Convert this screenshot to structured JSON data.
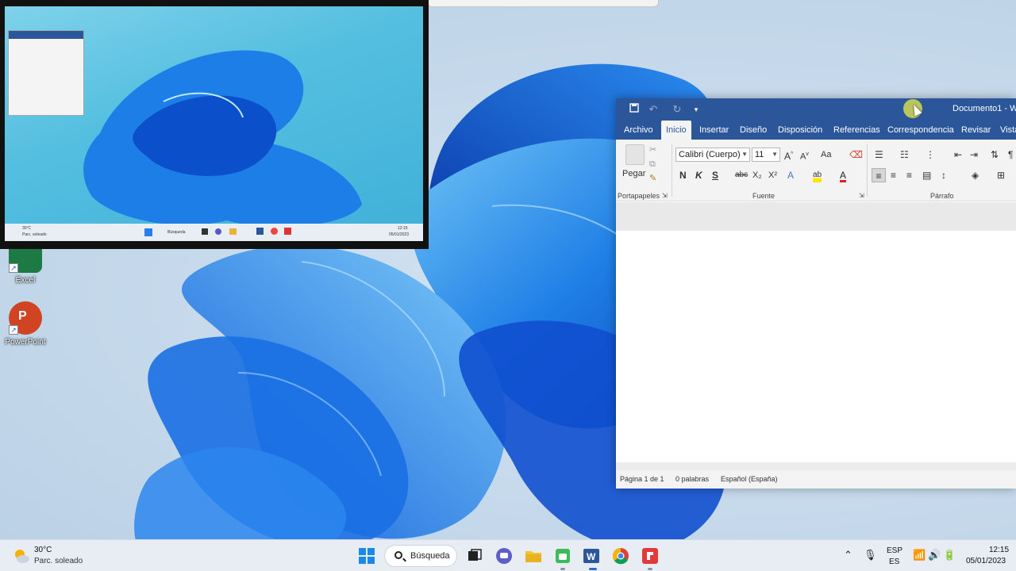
{
  "desktop": {
    "icons": [
      {
        "label": "Excel",
        "name": "excel"
      },
      {
        "label": "PowerPoint",
        "name": "powerpoint"
      }
    ]
  },
  "monitor_photo": {
    "weather_temp": "30°C",
    "weather_desc": "Parc. soleado",
    "search": "Búsqueda",
    "time": "12:15",
    "date": "05/01/2023"
  },
  "word": {
    "title": "Documento1 - W",
    "tabs": [
      "Archivo",
      "Inicio",
      "Insertar",
      "Diseño",
      "Disposición",
      "Referencias",
      "Correspondencia",
      "Revisar",
      "Vista"
    ],
    "active_tab": "Inicio",
    "clipboard": {
      "paste_label": "Pegar",
      "group_label": "Portapapeles"
    },
    "font": {
      "name": "Calibri (Cuerpo)",
      "size": "11",
      "group_label": "Fuente",
      "bold": "N",
      "italic": "K",
      "underline": "S",
      "strike": "abc",
      "sub": "X₂",
      "sup": "X²",
      "case": "Aa"
    },
    "paragraph": {
      "group_label": "Párrafo"
    },
    "status": {
      "page": "Página 1 de 1",
      "words": "0 palabras",
      "language": "Español (España)"
    },
    "accent": "#2b579a"
  },
  "taskbar": {
    "weather_temp": "30°C",
    "weather_desc": "Parc. soleado",
    "search_label": "Búsqueda",
    "lang_top": "ESP",
    "lang_bottom": "ES",
    "time": "12:15",
    "date": "05/01/2023"
  }
}
